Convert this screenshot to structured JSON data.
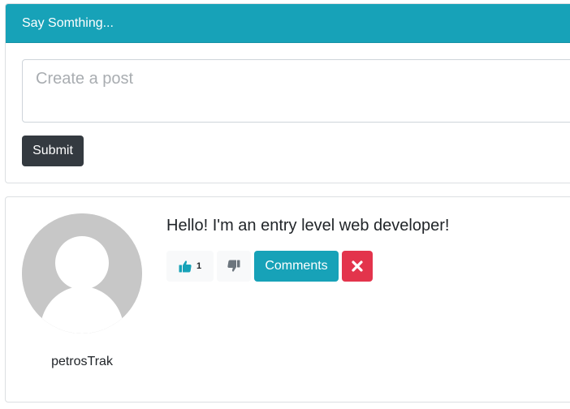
{
  "composer": {
    "header_title": "Say Somthing...",
    "placeholder": "Create a post",
    "value": "",
    "submit_label": "Submit"
  },
  "post": {
    "username": "petrosTrak",
    "text": "Hello! I'm an entry level web developer!",
    "like_count": "1",
    "comments_label": "Comments",
    "icons": {
      "like": "thumbs-up-icon",
      "dislike": "thumbs-down-icon",
      "delete": "close-icon",
      "avatar": "user-silhouette-icon"
    }
  },
  "colors": {
    "header_bg": "#17a2b8",
    "submit_bg": "#343a40",
    "comments_bg": "#17a2b8",
    "delete_bg": "#e3344c",
    "vote_bg": "#f8f9fa",
    "avatar_bg": "#c7c7c7"
  }
}
